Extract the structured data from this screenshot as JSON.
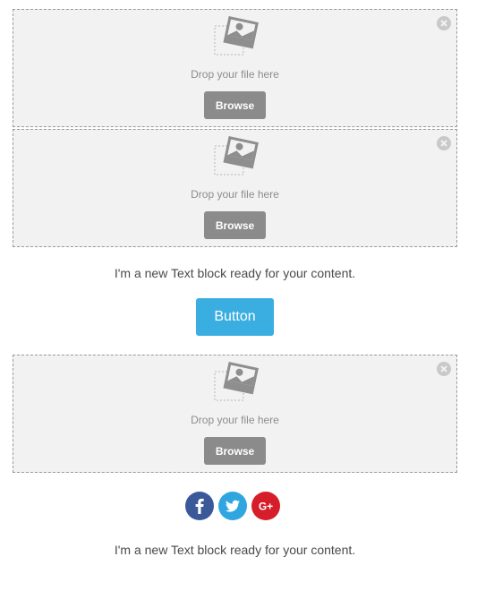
{
  "dropzones": [
    {
      "hint": "Drop your file here",
      "browse_label": "Browse"
    },
    {
      "hint": "Drop your file here",
      "browse_label": "Browse"
    },
    {
      "hint": "Drop your file here",
      "browse_label": "Browse"
    }
  ],
  "text_blocks": [
    "I'm a new Text block ready for your content.",
    "I'm a new Text block ready for your content."
  ],
  "button": {
    "label": "Button",
    "color": "#3aaee0"
  },
  "social": [
    {
      "name": "facebook",
      "glyph": "f",
      "color": "#3b5998"
    },
    {
      "name": "twitter",
      "glyph": "t",
      "color": "#2fa6e0"
    },
    {
      "name": "google-plus",
      "glyph": "G+",
      "color": "#d61e2a"
    }
  ]
}
